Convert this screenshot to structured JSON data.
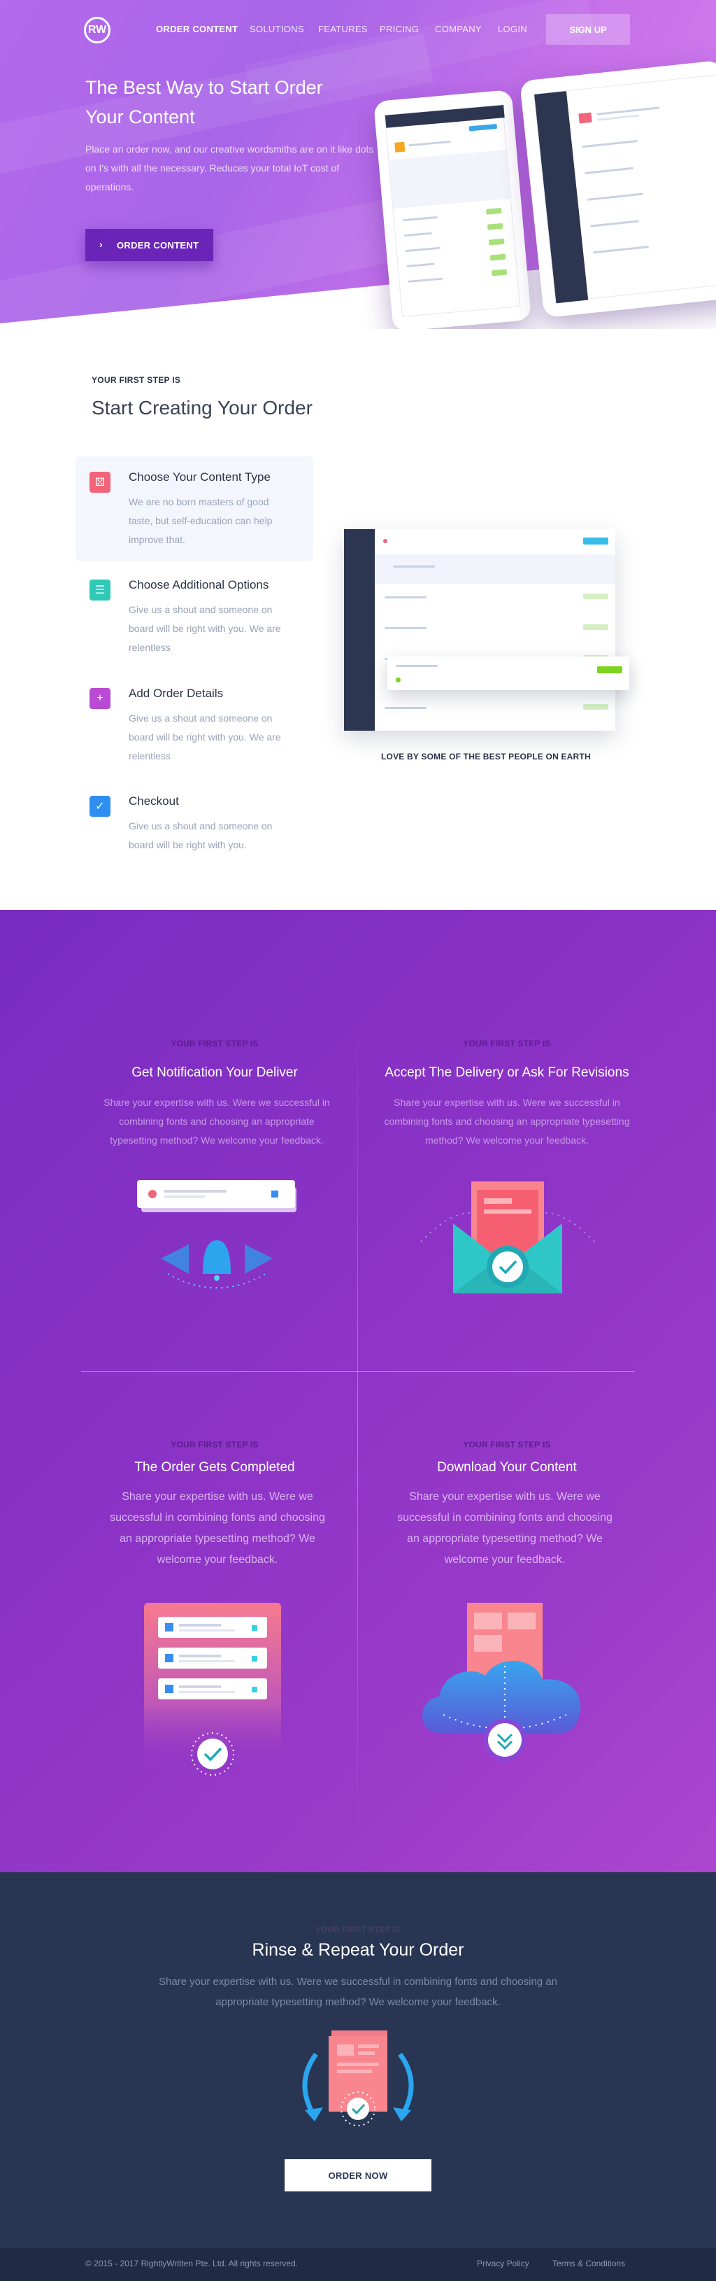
{
  "nav": {
    "logo": "RW",
    "items": [
      "ORDER CONTENT",
      "SOLUTIONS",
      "FEATURES",
      "PRICING",
      "COMPANY",
      "LOGIN"
    ],
    "signup": "SIGN UP"
  },
  "hero": {
    "title": "The Best Way to Start Order Your Content",
    "description": "Place an order now, and our creative wordsmiths are on it like dots on I's with all the necessary. Reduces your total IoT cost of operations.",
    "cta": "ORDER CONTENT"
  },
  "steps": {
    "kicker": "YOUR FIRST STEP IS",
    "title": "Start Creating Your Order",
    "items": [
      {
        "title": "Choose Your Content Type",
        "desc": "We are no born masters of good taste, but self-education can help improve that.",
        "color": "#f16479",
        "icon": "dice-icon"
      },
      {
        "title": "Choose Additional Options",
        "desc": "Give us a shout and someone on board will be right with you. We are relentless",
        "color": "#2fc9b8",
        "icon": "list-icon"
      },
      {
        "title": "Add Order Details",
        "desc": "Give us a shout and someone on board will be right with you. We are relentless",
        "color": "#b94ad3",
        "icon": "plus-icon"
      },
      {
        "title": "Checkout",
        "desc": "Give us a shout and someone on board will be right with you.",
        "color": "#2f8ff0",
        "icon": "check-icon"
      }
    ],
    "love": "LOVE BY SOME OF THE BEST PEOPLE ON EARTH"
  },
  "process": {
    "items": [
      {
        "kicker": "YOUR FIRST STEP IS",
        "title": "Get Notification Your Deliver",
        "desc": "Share your expertise with us. Were we successful in combining fonts and choosing an appropriate typesetting method? We welcome your feedback."
      },
      {
        "kicker": "YOUR FIRST STEP IS",
        "title": "Accept The Delivery or Ask For Revisions",
        "desc": "Share your expertise with us. Were we successful in combining fonts and choosing an appropriate typesetting method? We welcome your feedback."
      },
      {
        "kicker": "YOUR FIRST STEP IS",
        "title": "The Order Gets Completed",
        "desc": "Share your expertise with us. Were we successful in combining fonts and choosing an appropriate typesetting method? We welcome your feedback."
      },
      {
        "kicker": "YOUR FIRST STEP IS",
        "title": "Download Your Content",
        "desc": "Share your expertise with us. Were we successful in combining fonts and choosing an appropriate typesetting method? We welcome your feedback."
      }
    ]
  },
  "repeat": {
    "kicker": "YOUR FIRST STEP IS",
    "title": "Rinse & Repeat Your Order",
    "desc": "Share your expertise with us. Were we successful in combining fonts and choosing an appropriate typesetting method? We welcome your feedback.",
    "cta": "ORDER NOW"
  },
  "footer": {
    "copyright": "© 2015 - 2017 RightlyWritten Pte. Ltd. All rights reserved.",
    "privacy": "Privacy Policy",
    "terms": "Terms & Conditions"
  }
}
